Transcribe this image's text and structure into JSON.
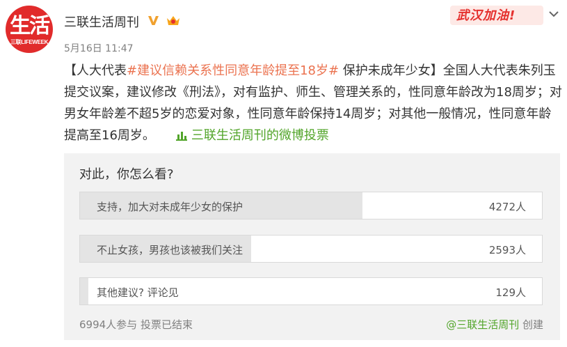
{
  "author": {
    "avatar_text": "生活",
    "avatar_subtext": "三联LIFEWEEK",
    "name": "三联生活周刊",
    "verified_icon": "verified-v-icon",
    "vip_icon": "vip-crown-icon"
  },
  "post_time": "5月16日 11:47",
  "header_stamp": "武汉加油!",
  "post": {
    "bracket_open": "【人大代表",
    "hashtag": "#建议信赖关系性同意年龄提至18岁#",
    "text": " 保护未成年少女】全国人大代表朱列玉提交议案，建议修改《刑法》，对有监护、师生、管理关系的，性同意年龄改为18周岁；对男女年龄差不超5岁的恋爱对象，性同意年龄保持14周岁；对其他一般情况，性同意年龄提高至16周岁。",
    "vote_link": "三联生活周刊的微博投票"
  },
  "poll": {
    "question": "对此，你怎么看?",
    "options": [
      {
        "label": "支持，加大对未成年少女的保护",
        "count": "4272人",
        "share": 0.611
      },
      {
        "label": "不止女孩，男孩也该被我们关注",
        "count": "2593人",
        "share": 0.371
      },
      {
        "label": "其他建议? 评论见",
        "count": "129人",
        "share": 0.018
      }
    ],
    "summary": "6994人参与 投票已结束",
    "creator_account": "@三联生活周刊",
    "creator_suffix": " 创建"
  },
  "colors": {
    "link": "#eb7350",
    "green": "#52a52a",
    "brand_red": "#e12b2b"
  }
}
